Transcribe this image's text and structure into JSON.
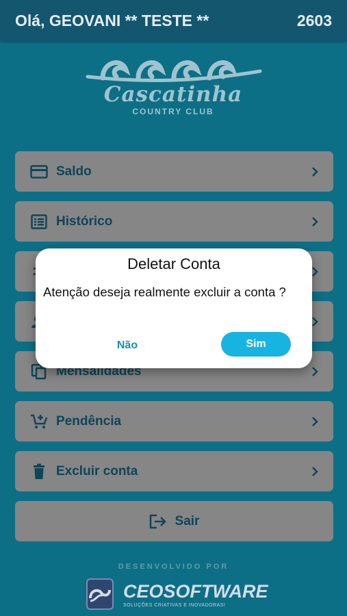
{
  "header": {
    "greeting": "Olá, GEOVANI ** TESTE **",
    "code": "2603"
  },
  "brand": {
    "name": "Cascatinha",
    "subtitle": "COUNTRY CLUB"
  },
  "menu": {
    "items": [
      {
        "label": "Saldo",
        "icon": "credit-card-icon"
      },
      {
        "label": "Histórico",
        "icon": "list-icon"
      },
      {
        "label": "",
        "icon": "menu-icon"
      },
      {
        "label": "",
        "icon": "person-icon"
      },
      {
        "label": "Mensalidades",
        "icon": "copy-icon"
      },
      {
        "label": "Pendência",
        "icon": "cart-add-icon"
      },
      {
        "label": "Excluir conta",
        "icon": "trash-icon"
      }
    ],
    "exit_label": "Sair"
  },
  "footer": {
    "developed_by": "DESENVOLVIDO POR",
    "company": "CEOSOFTWARE",
    "tagline": "SOLUÇÕES CRIATIVAS E INOVADORAS!"
  },
  "dialog": {
    "title": "Deletar Conta",
    "message": "Atenção deseja realmente excluir a conta ?",
    "cancel_label": "Não",
    "confirm_label": "Sim"
  },
  "colors": {
    "background": "#0d6f86",
    "appbar": "#15566f",
    "menu_item": "#868686",
    "menu_text": "#0e4558",
    "confirm_button": "#17b4e1"
  }
}
